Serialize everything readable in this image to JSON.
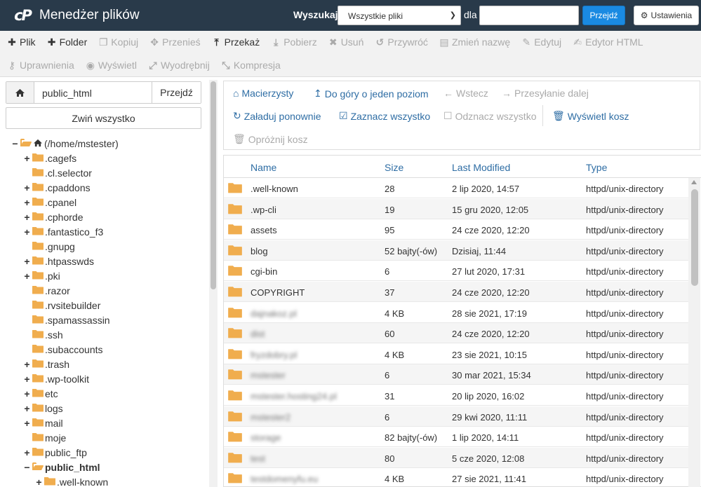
{
  "header": {
    "app_title": "Menedżer plików",
    "search_label": "Wyszukaj",
    "search_scope": "Wszystkie pliki",
    "dla_label": "dla",
    "search_value": "",
    "search_button": "Przejdź",
    "settings_button": "Ustawienia"
  },
  "toolbar": {
    "row1": [
      {
        "label": "Plik",
        "enabled": true,
        "icon": "plus-icon",
        "glyph": "✚"
      },
      {
        "label": "Folder",
        "enabled": true,
        "icon": "plus-icon",
        "glyph": "✚"
      },
      {
        "label": "Kopiuj",
        "enabled": false,
        "icon": "copy-icon",
        "glyph": "❐"
      },
      {
        "label": "Przenieś",
        "enabled": false,
        "icon": "move-icon",
        "glyph": "✥"
      },
      {
        "label": "Przekaż",
        "enabled": true,
        "icon": "upload-icon",
        "glyph": "⤒"
      },
      {
        "label": "Pobierz",
        "enabled": false,
        "icon": "download-icon",
        "glyph": "⤓"
      },
      {
        "label": "Usuń",
        "enabled": false,
        "icon": "delete-icon",
        "glyph": "✖"
      },
      {
        "label": "Przywróć",
        "enabled": false,
        "icon": "restore-icon",
        "glyph": "↺"
      },
      {
        "label": "Zmień nazwę",
        "enabled": false,
        "icon": "rename-icon",
        "glyph": "▤"
      },
      {
        "label": "Edytuj",
        "enabled": false,
        "icon": "edit-icon",
        "glyph": "✎"
      },
      {
        "label": "Edytor HTML",
        "enabled": false,
        "icon": "html-editor-icon",
        "glyph": "✍"
      }
    ],
    "row2": [
      {
        "label": "Uprawnienia",
        "enabled": false,
        "icon": "key-icon",
        "glyph": "⚷"
      },
      {
        "label": "Wyświetl",
        "enabled": false,
        "icon": "eye-icon",
        "glyph": "◉"
      },
      {
        "label": "Wyodrębnij",
        "enabled": false,
        "icon": "extract-icon",
        "glyph": "⤢"
      },
      {
        "label": "Kompresja",
        "enabled": false,
        "icon": "compress-icon",
        "glyph": "⤡"
      }
    ]
  },
  "left_panel": {
    "path_value": "public_html",
    "path_go": "Przejdź",
    "collapse_all": "Zwiń wszystko",
    "tree": [
      {
        "label": "(/home/mstester)",
        "level": 0,
        "toggle": "−",
        "open": true,
        "home": true
      },
      {
        "label": ".cagefs",
        "level": 1,
        "toggle": "+"
      },
      {
        "label": ".cl.selector",
        "level": 1,
        "toggle": ""
      },
      {
        "label": ".cpaddons",
        "level": 1,
        "toggle": "+"
      },
      {
        "label": ".cpanel",
        "level": 1,
        "toggle": "+"
      },
      {
        "label": ".cphorde",
        "level": 1,
        "toggle": "+"
      },
      {
        "label": ".fantastico_f3",
        "level": 1,
        "toggle": "+"
      },
      {
        "label": ".gnupg",
        "level": 1,
        "toggle": ""
      },
      {
        "label": ".htpasswds",
        "level": 1,
        "toggle": "+"
      },
      {
        "label": ".pki",
        "level": 1,
        "toggle": "+"
      },
      {
        "label": ".razor",
        "level": 1,
        "toggle": ""
      },
      {
        "label": ".rvsitebuilder",
        "level": 1,
        "toggle": ""
      },
      {
        "label": ".spamassassin",
        "level": 1,
        "toggle": ""
      },
      {
        "label": ".ssh",
        "level": 1,
        "toggle": ""
      },
      {
        "label": ".subaccounts",
        "level": 1,
        "toggle": ""
      },
      {
        "label": ".trash",
        "level": 1,
        "toggle": "+"
      },
      {
        "label": ".wp-toolkit",
        "level": 1,
        "toggle": "+"
      },
      {
        "label": "etc",
        "level": 1,
        "toggle": "+"
      },
      {
        "label": "logs",
        "level": 1,
        "toggle": "+"
      },
      {
        "label": "mail",
        "level": 1,
        "toggle": "+"
      },
      {
        "label": "moje",
        "level": 1,
        "toggle": ""
      },
      {
        "label": "public_ftp",
        "level": 1,
        "toggle": "+"
      },
      {
        "label": "public_html",
        "level": 1,
        "toggle": "−",
        "open": true,
        "bold": true
      },
      {
        "label": ".well-known",
        "level": 2,
        "toggle": "+"
      }
    ]
  },
  "nav": {
    "home": "Macierzysty",
    "up": "Do góry o jeden poziom",
    "back": "Wstecz",
    "forward": "Przesyłanie dalej",
    "reload": "Załaduj ponownie",
    "select_all": "Zaznacz wszystko",
    "unselect_all": "Odznacz wszystko",
    "view_trash": "Wyświetl kosz",
    "empty_trash": "Opróżnij kosz"
  },
  "files": {
    "columns": {
      "name": "Name",
      "size": "Size",
      "modified": "Last Modified",
      "type": "Type"
    },
    "rows": [
      {
        "name": ".well-known",
        "size": "28",
        "modified": "2 lip 2020, 14:57",
        "type": "httpd/unix-directory",
        "blurred": false
      },
      {
        "name": ".wp-cli",
        "size": "19",
        "modified": "15 gru 2020, 12:05",
        "type": "httpd/unix-directory",
        "blurred": false
      },
      {
        "name": "assets",
        "size": "95",
        "modified": "24 cze 2020, 12:20",
        "type": "httpd/unix-directory",
        "blurred": false
      },
      {
        "name": "blog",
        "size": "52 bajty(-ów)",
        "modified": "Dzisiaj, 11:44",
        "type": "httpd/unix-directory",
        "blurred": false
      },
      {
        "name": "cgi-bin",
        "size": "6",
        "modified": "27 lut 2020, 17:31",
        "type": "httpd/unix-directory",
        "blurred": false
      },
      {
        "name": "COPYRIGHT",
        "size": "37",
        "modified": "24 cze 2020, 12:20",
        "type": "httpd/unix-directory",
        "blurred": false
      },
      {
        "name": "dajnakoz.pl",
        "size": "4 KB",
        "modified": "28 sie 2021, 17:19",
        "type": "httpd/unix-directory",
        "blurred": true
      },
      {
        "name": "dist",
        "size": "60",
        "modified": "24 cze 2020, 12:20",
        "type": "httpd/unix-directory",
        "blurred": true
      },
      {
        "name": "fryzdobry.pl",
        "size": "4 KB",
        "modified": "23 sie 2021, 10:15",
        "type": "httpd/unix-directory",
        "blurred": true
      },
      {
        "name": "mstester",
        "size": "6",
        "modified": "30 mar 2021, 15:34",
        "type": "httpd/unix-directory",
        "blurred": true
      },
      {
        "name": "mstester.hosting24.pl",
        "size": "31",
        "modified": "20 lip 2020, 16:02",
        "type": "httpd/unix-directory",
        "blurred": true
      },
      {
        "name": "mstester2",
        "size": "6",
        "modified": "29 kwi 2020, 11:11",
        "type": "httpd/unix-directory",
        "blurred": true
      },
      {
        "name": "storage",
        "size": "82 bajty(-ów)",
        "modified": "1 lip 2020, 14:11",
        "type": "httpd/unix-directory",
        "blurred": true
      },
      {
        "name": "test",
        "size": "80",
        "modified": "5 cze 2020, 12:08",
        "type": "httpd/unix-directory",
        "blurred": true
      },
      {
        "name": "testdomenyfu.eu",
        "size": "4 KB",
        "modified": "27 sie 2021, 11:41",
        "type": "httpd/unix-directory",
        "blurred": true
      }
    ]
  },
  "colors": {
    "header_bg": "#293a4a",
    "accent": "#1a8ae2",
    "link": "#2e6da4",
    "folder": "#f0ad4e"
  }
}
